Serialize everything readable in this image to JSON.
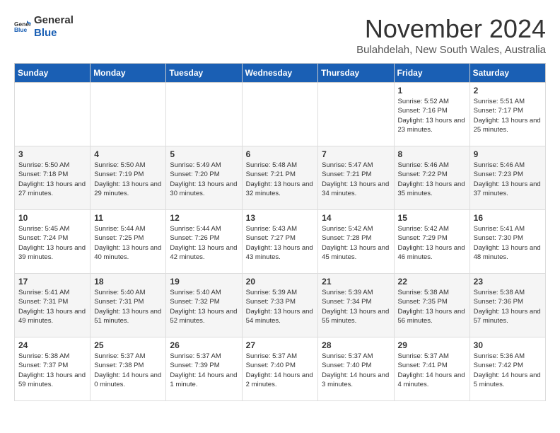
{
  "logo": {
    "line1": "General",
    "line2": "Blue"
  },
  "title": "November 2024",
  "location": "Bulahdelah, New South Wales, Australia",
  "days_of_week": [
    "Sunday",
    "Monday",
    "Tuesday",
    "Wednesday",
    "Thursday",
    "Friday",
    "Saturday"
  ],
  "weeks": [
    [
      {
        "day": "",
        "info": ""
      },
      {
        "day": "",
        "info": ""
      },
      {
        "day": "",
        "info": ""
      },
      {
        "day": "",
        "info": ""
      },
      {
        "day": "",
        "info": ""
      },
      {
        "day": "1",
        "info": "Sunrise: 5:52 AM\nSunset: 7:16 PM\nDaylight: 13 hours and 23 minutes."
      },
      {
        "day": "2",
        "info": "Sunrise: 5:51 AM\nSunset: 7:17 PM\nDaylight: 13 hours and 25 minutes."
      }
    ],
    [
      {
        "day": "3",
        "info": "Sunrise: 5:50 AM\nSunset: 7:18 PM\nDaylight: 13 hours and 27 minutes."
      },
      {
        "day": "4",
        "info": "Sunrise: 5:50 AM\nSunset: 7:19 PM\nDaylight: 13 hours and 29 minutes."
      },
      {
        "day": "5",
        "info": "Sunrise: 5:49 AM\nSunset: 7:20 PM\nDaylight: 13 hours and 30 minutes."
      },
      {
        "day": "6",
        "info": "Sunrise: 5:48 AM\nSunset: 7:21 PM\nDaylight: 13 hours and 32 minutes."
      },
      {
        "day": "7",
        "info": "Sunrise: 5:47 AM\nSunset: 7:21 PM\nDaylight: 13 hours and 34 minutes."
      },
      {
        "day": "8",
        "info": "Sunrise: 5:46 AM\nSunset: 7:22 PM\nDaylight: 13 hours and 35 minutes."
      },
      {
        "day": "9",
        "info": "Sunrise: 5:46 AM\nSunset: 7:23 PM\nDaylight: 13 hours and 37 minutes."
      }
    ],
    [
      {
        "day": "10",
        "info": "Sunrise: 5:45 AM\nSunset: 7:24 PM\nDaylight: 13 hours and 39 minutes."
      },
      {
        "day": "11",
        "info": "Sunrise: 5:44 AM\nSunset: 7:25 PM\nDaylight: 13 hours and 40 minutes."
      },
      {
        "day": "12",
        "info": "Sunrise: 5:44 AM\nSunset: 7:26 PM\nDaylight: 13 hours and 42 minutes."
      },
      {
        "day": "13",
        "info": "Sunrise: 5:43 AM\nSunset: 7:27 PM\nDaylight: 13 hours and 43 minutes."
      },
      {
        "day": "14",
        "info": "Sunrise: 5:42 AM\nSunset: 7:28 PM\nDaylight: 13 hours and 45 minutes."
      },
      {
        "day": "15",
        "info": "Sunrise: 5:42 AM\nSunset: 7:29 PM\nDaylight: 13 hours and 46 minutes."
      },
      {
        "day": "16",
        "info": "Sunrise: 5:41 AM\nSunset: 7:30 PM\nDaylight: 13 hours and 48 minutes."
      }
    ],
    [
      {
        "day": "17",
        "info": "Sunrise: 5:41 AM\nSunset: 7:31 PM\nDaylight: 13 hours and 49 minutes."
      },
      {
        "day": "18",
        "info": "Sunrise: 5:40 AM\nSunset: 7:31 PM\nDaylight: 13 hours and 51 minutes."
      },
      {
        "day": "19",
        "info": "Sunrise: 5:40 AM\nSunset: 7:32 PM\nDaylight: 13 hours and 52 minutes."
      },
      {
        "day": "20",
        "info": "Sunrise: 5:39 AM\nSunset: 7:33 PM\nDaylight: 13 hours and 54 minutes."
      },
      {
        "day": "21",
        "info": "Sunrise: 5:39 AM\nSunset: 7:34 PM\nDaylight: 13 hours and 55 minutes."
      },
      {
        "day": "22",
        "info": "Sunrise: 5:38 AM\nSunset: 7:35 PM\nDaylight: 13 hours and 56 minutes."
      },
      {
        "day": "23",
        "info": "Sunrise: 5:38 AM\nSunset: 7:36 PM\nDaylight: 13 hours and 57 minutes."
      }
    ],
    [
      {
        "day": "24",
        "info": "Sunrise: 5:38 AM\nSunset: 7:37 PM\nDaylight: 13 hours and 59 minutes."
      },
      {
        "day": "25",
        "info": "Sunrise: 5:37 AM\nSunset: 7:38 PM\nDaylight: 14 hours and 0 minutes."
      },
      {
        "day": "26",
        "info": "Sunrise: 5:37 AM\nSunset: 7:39 PM\nDaylight: 14 hours and 1 minute."
      },
      {
        "day": "27",
        "info": "Sunrise: 5:37 AM\nSunset: 7:40 PM\nDaylight: 14 hours and 2 minutes."
      },
      {
        "day": "28",
        "info": "Sunrise: 5:37 AM\nSunset: 7:40 PM\nDaylight: 14 hours and 3 minutes."
      },
      {
        "day": "29",
        "info": "Sunrise: 5:37 AM\nSunset: 7:41 PM\nDaylight: 14 hours and 4 minutes."
      },
      {
        "day": "30",
        "info": "Sunrise: 5:36 AM\nSunset: 7:42 PM\nDaylight: 14 hours and 5 minutes."
      }
    ]
  ]
}
